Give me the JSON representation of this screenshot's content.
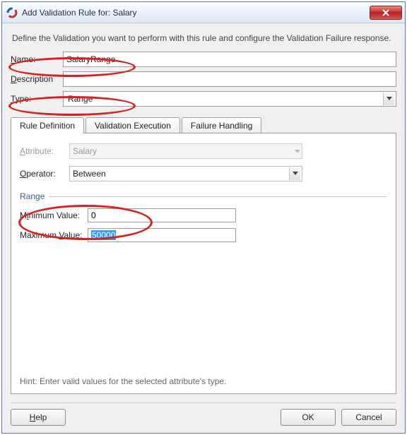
{
  "title": "Add Validation Rule for: Salary",
  "intro": "Define the Validation you want to perform with this rule and configure the Validation Failure response.",
  "labels": {
    "name": "Name:",
    "name_u": "N",
    "description": "Description",
    "type": "Type:",
    "type_u": "T"
  },
  "fields": {
    "name_value": "SalaryRange",
    "description_value": "",
    "type_value": "Range"
  },
  "tabs": {
    "t1": "Rule Definition",
    "t2": "Validation Execution",
    "t3": "Failure Handling"
  },
  "panel": {
    "attribute_label": "Attribute:",
    "attribute_underline": "A",
    "attribute_value": "Salary",
    "operator_label": "Operator:",
    "operator_underline": "O",
    "operator_value": "Between",
    "range_header": "Range",
    "min_label_pre": "M",
    "min_label_u": "i",
    "min_label_post": "nimum Value:",
    "max_label_pre": "Maximum ",
    "max_label_u": "V",
    "max_label_post": "alue:",
    "min_value": "0",
    "max_value": "50000",
    "hint": "Hint: Enter valid values for the selected attribute's type."
  },
  "buttons": {
    "help": "Help",
    "help_u": "H",
    "ok": "OK",
    "cancel": "Cancel"
  }
}
